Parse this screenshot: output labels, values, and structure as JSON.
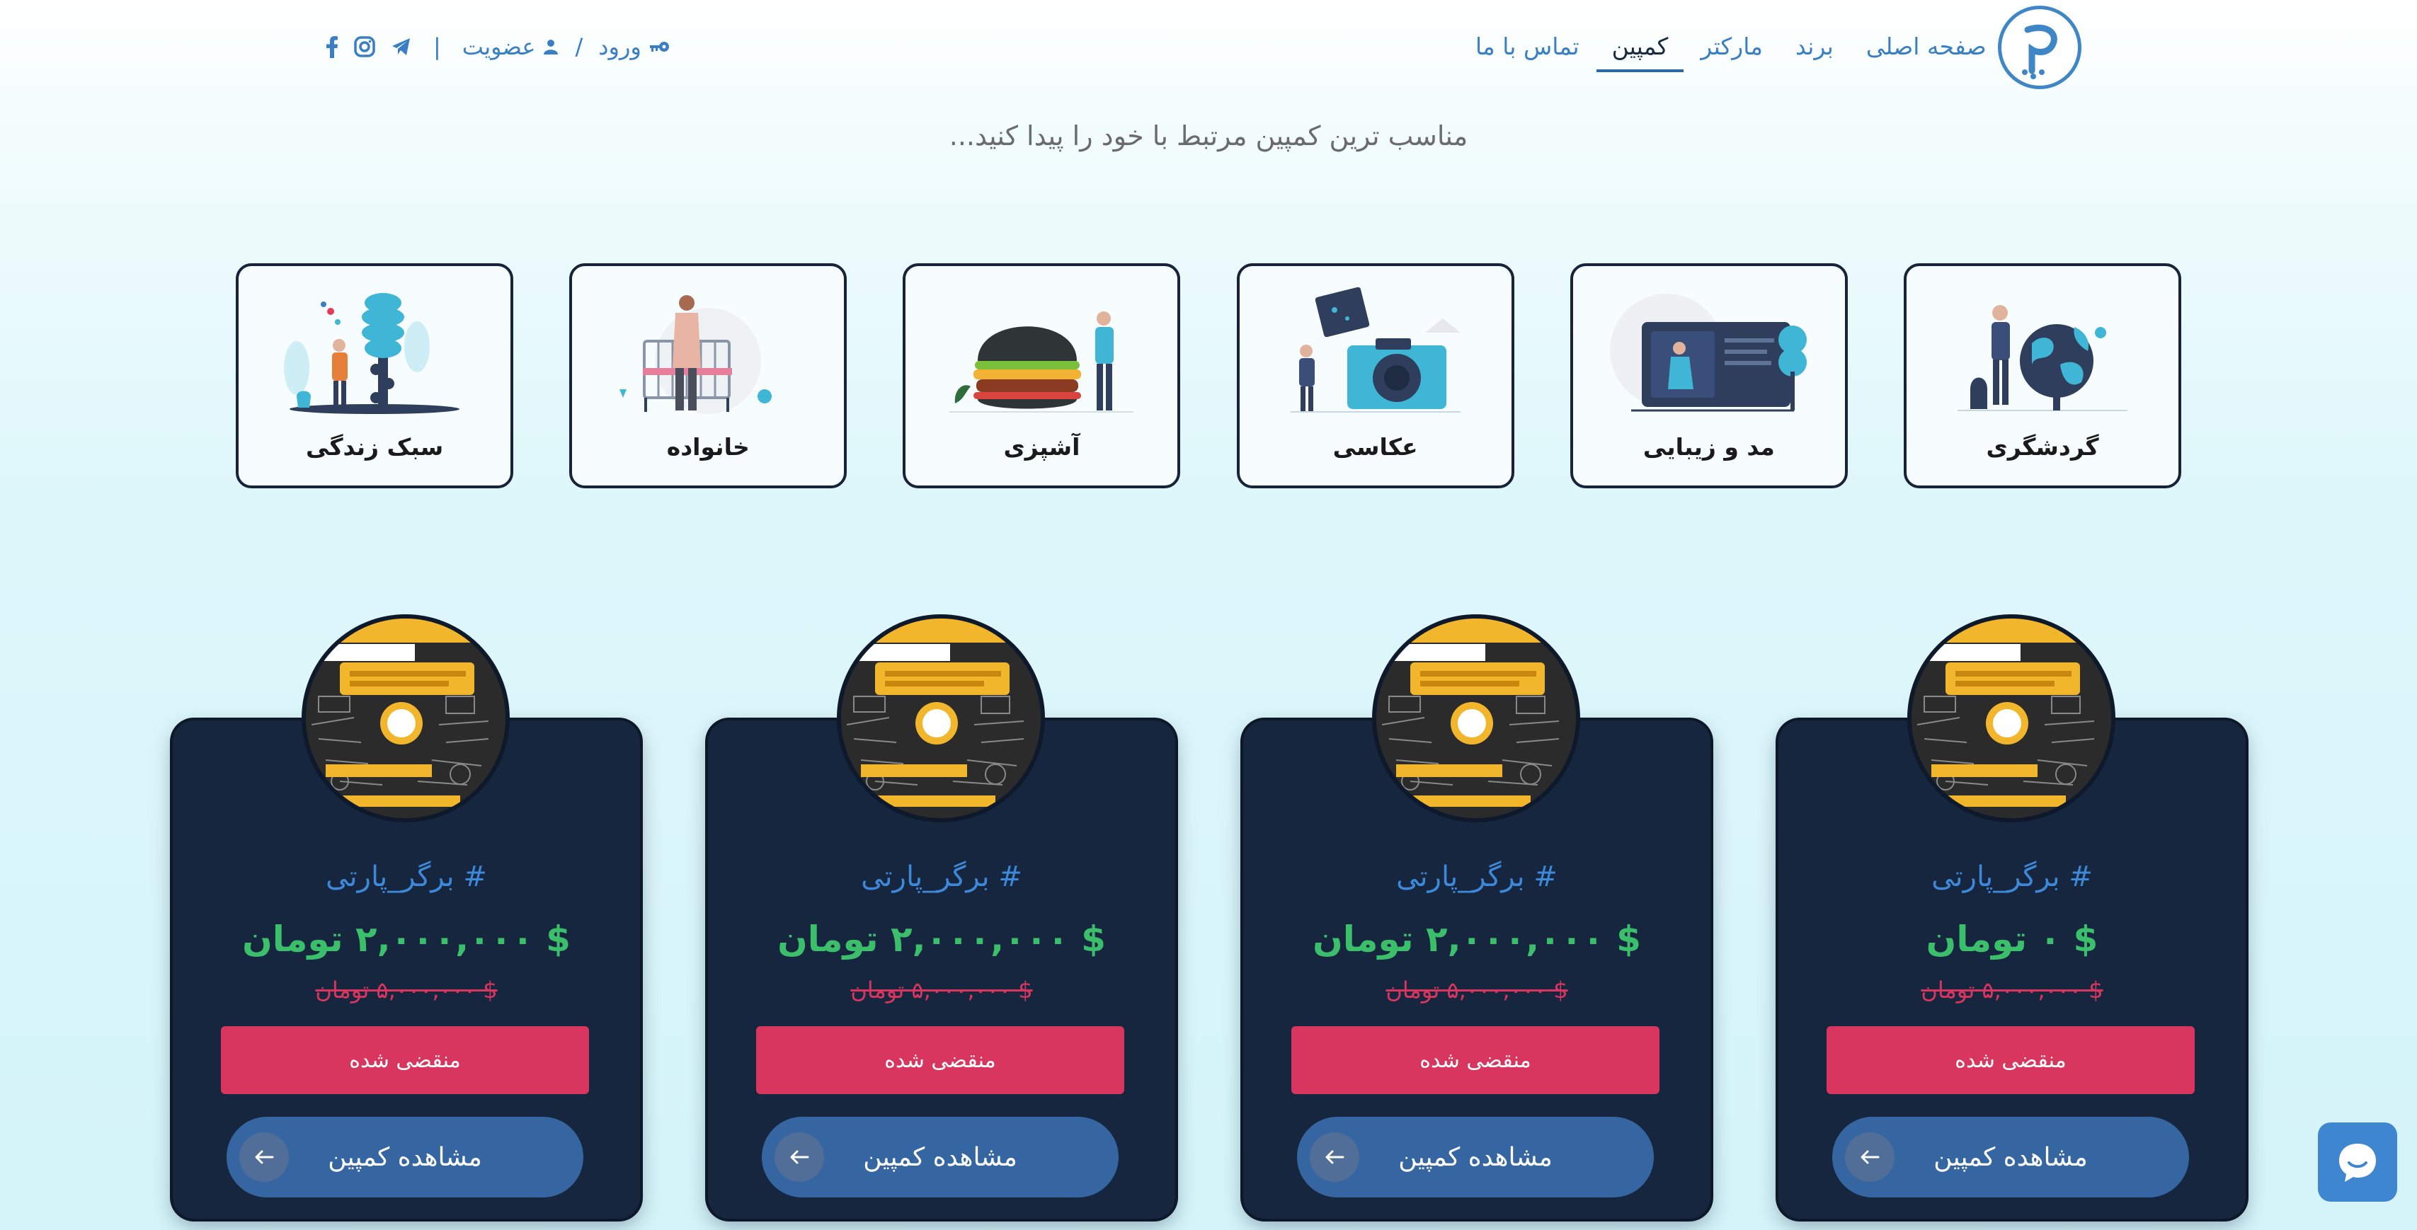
{
  "header": {
    "logo_alt": "پ",
    "nav": [
      {
        "label": "صفحه اصلی",
        "active": false
      },
      {
        "label": "برند",
        "active": false
      },
      {
        "label": "مارکتر",
        "active": false
      },
      {
        "label": "کمپین",
        "active": true
      },
      {
        "label": "تماس با ما",
        "active": false
      }
    ],
    "auth": {
      "login": "ورود",
      "slash": "/",
      "register": "عضویت",
      "divider": "|"
    }
  },
  "subtitle": "مناسب ترین کمپین مرتبط با خود را پیدا کنید...",
  "categories": [
    {
      "label": "گردشگری",
      "icon": "travel-illustration"
    },
    {
      "label": "مد و زیبایی",
      "icon": "fashion-illustration"
    },
    {
      "label": "عکاسی",
      "icon": "photography-illustration"
    },
    {
      "label": "آشپزی",
      "icon": "cooking-illustration"
    },
    {
      "label": "خانواده",
      "icon": "family-illustration"
    },
    {
      "label": "سبک زندگی",
      "icon": "lifestyle-illustration"
    }
  ],
  "campaigns": [
    {
      "tag": "# برگر_پارتی",
      "price": "$ ۰ تومان",
      "old_price": "$ ۵,۰۰۰,۰۰۰ تومان",
      "status": "منقضی شده",
      "cta": "مشاهده کمپین"
    },
    {
      "tag": "# برگر_پارتی",
      "price": "$ ۲,۰۰۰,۰۰۰ تومان",
      "old_price": "$ ۵,۰۰۰,۰۰۰ تومان",
      "status": "منقضی شده",
      "cta": "مشاهده کمپین"
    },
    {
      "tag": "# برگر_پارتی",
      "price": "$ ۲,۰۰۰,۰۰۰ تومان",
      "old_price": "$ ۵,۰۰۰,۰۰۰ تومان",
      "status": "منقضی شده",
      "cta": "مشاهده کمپین"
    },
    {
      "tag": "# برگر_پارتی",
      "price": "$ ۲,۰۰۰,۰۰۰ تومان",
      "old_price": "$ ۵,۰۰۰,۰۰۰ تومان",
      "status": "منقضی شده",
      "cta": "مشاهده کمپین"
    }
  ],
  "colors": {
    "accent": "#3a7fc3",
    "card_bg": "#16263f",
    "price": "#3bbf6b",
    "danger": "#d8355f",
    "button": "#3666a1"
  }
}
